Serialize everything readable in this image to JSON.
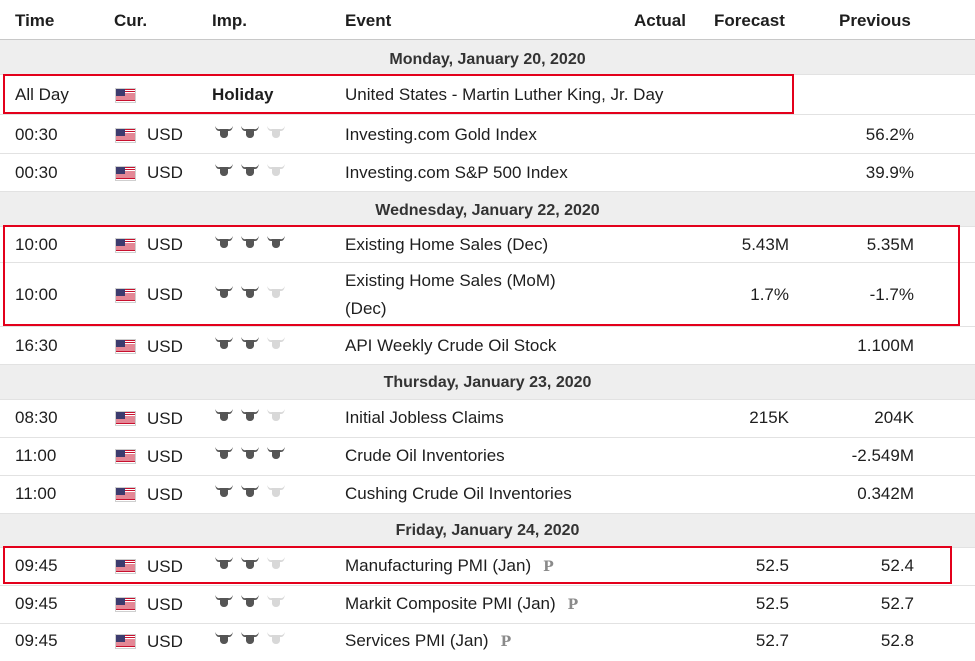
{
  "header": {
    "time": "Time",
    "currency": "Cur.",
    "importance": "Imp.",
    "event": "Event",
    "actual": "Actual",
    "forecast": "Forecast",
    "previous": "Previous"
  },
  "days": [
    {
      "label": "Monday, January 20, 2020"
    },
    {
      "label": "Wednesday, January 22, 2020"
    },
    {
      "label": "Thursday, January 23, 2020"
    },
    {
      "label": "Friday, January 24, 2020"
    }
  ],
  "events": [
    {
      "time": "All Day",
      "currency": "",
      "importance": 0,
      "importance_text": "Holiday",
      "event": "United States - Martin Luther King, Jr. Day",
      "forecast": "",
      "previous": ""
    },
    {
      "time": "00:30",
      "currency": "USD",
      "importance": 2,
      "event": "Investing.com Gold Index",
      "forecast": "",
      "previous": "56.2%"
    },
    {
      "time": "00:30",
      "currency": "USD",
      "importance": 2,
      "event": "Investing.com S&P 500 Index",
      "forecast": "",
      "previous": "39.9%"
    },
    {
      "time": "10:00",
      "currency": "USD",
      "importance": 3,
      "event": "Existing Home Sales (Dec)",
      "forecast": "5.43M",
      "previous": "5.35M"
    },
    {
      "time": "10:00",
      "currency": "USD",
      "importance": 2,
      "event_line1": "Existing Home Sales (MoM)",
      "event_line2": "(Dec)",
      "forecast": "1.7%",
      "previous": "-1.7%"
    },
    {
      "time": "16:30",
      "currency": "USD",
      "importance": 2,
      "event": "API Weekly Crude Oil Stock",
      "forecast": "",
      "previous": "1.100M"
    },
    {
      "time": "08:30",
      "currency": "USD",
      "importance": 2,
      "event": "Initial Jobless Claims",
      "forecast": "215K",
      "previous": "204K"
    },
    {
      "time": "11:00",
      "currency": "USD",
      "importance": 3,
      "event": "Crude Oil Inventories",
      "forecast": "",
      "previous": "-2.549M"
    },
    {
      "time": "11:00",
      "currency": "USD",
      "importance": 2,
      "event": "Cushing Crude Oil Inventories",
      "forecast": "",
      "previous": "0.342M"
    },
    {
      "time": "09:45",
      "currency": "USD",
      "importance": 2,
      "event": "Manufacturing PMI (Jan)",
      "badge": "P",
      "forecast": "52.5",
      "previous": "52.4"
    },
    {
      "time": "09:45",
      "currency": "USD",
      "importance": 2,
      "event": "Markit Composite PMI (Jan)",
      "badge": "P",
      "forecast": "52.5",
      "previous": "52.7"
    },
    {
      "time": "09:45",
      "currency": "USD",
      "importance": 2,
      "event": "Services PMI (Jan)",
      "badge": "P",
      "forecast": "52.7",
      "previous": "52.8"
    }
  ],
  "colors": {
    "bull_active": "#555555",
    "bull_inactive": "#d8d8d8",
    "highlight": "#e3001b",
    "day_bg": "#eeeeee"
  },
  "icons": {
    "flag": "us-flag-icon",
    "importance": "bull-icon",
    "preliminary": "preliminary-p-icon"
  }
}
